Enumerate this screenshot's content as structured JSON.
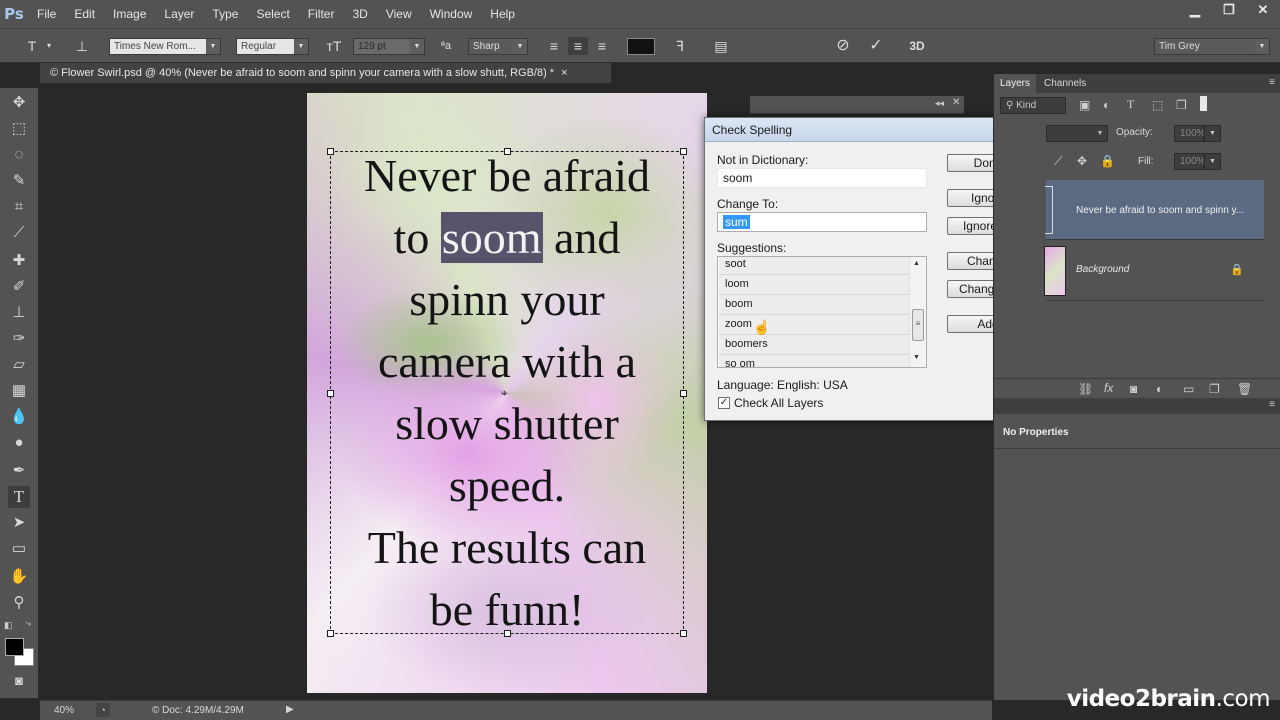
{
  "app": {
    "logo": "Ps",
    "menu": [
      "File",
      "Edit",
      "Image",
      "Layer",
      "Type",
      "Select",
      "Filter",
      "3D",
      "View",
      "Window",
      "Help"
    ],
    "window_controls": {
      "minimize": "▁",
      "restore": "❐",
      "close": "✕"
    }
  },
  "options_bar": {
    "font_family": "Times New Rom...",
    "font_style": "Regular",
    "font_size": "129 pt",
    "aa_label": "ªa",
    "anti_alias": "Sharp",
    "text_color": "#111111",
    "workspace": "Tim Grey",
    "three_d": "3D"
  },
  "document": {
    "tab_title": "© Flower Swirl.psd @ 40% (Never be afraid to soom and spinn your camera with a slow shutt, RGB/8) *",
    "tab_close": "×",
    "lines": [
      {
        "pre": "Never be afraid",
        "hl": "",
        "post": ""
      },
      {
        "pre": "to ",
        "hl": "soom",
        "post": " and"
      },
      {
        "pre": "spinn your",
        "hl": "",
        "post": ""
      },
      {
        "pre": "camera with a",
        "hl": "",
        "post": ""
      },
      {
        "pre": "slow shutter",
        "hl": "",
        "post": ""
      },
      {
        "pre": "speed.",
        "hl": "",
        "post": ""
      },
      {
        "pre": "The results can",
        "hl": "",
        "post": ""
      },
      {
        "pre": "be funn!",
        "hl": "",
        "post": ""
      }
    ]
  },
  "dialog": {
    "title": "Check Spelling",
    "close": "✕",
    "not_in_dictionary_label": "Not in Dictionary:",
    "not_in_dictionary_value": "soom",
    "change_to_label": "Change To:",
    "change_to_value": "sum",
    "suggestions_label": "Suggestions:",
    "suggestions": [
      "soot",
      "loom",
      "boom",
      "zoom",
      "boomers",
      "so om"
    ],
    "buttons": {
      "done": "Done",
      "ignore": "Ignore",
      "ignore_all": "Ignore All",
      "change": "Change",
      "change_all": "Change All",
      "add": "Add"
    },
    "language": "Language: English: USA",
    "check_all_layers": "Check All Layers",
    "check_all_layers_checked": true
  },
  "layers_panel": {
    "tabs": [
      "Layers",
      "Channels"
    ],
    "filter_kind": "Kind",
    "opacity_label": "Opacity:",
    "opacity_value": "100%",
    "fill_label": "Fill:",
    "fill_value": "100%",
    "layers": [
      {
        "name": "Never be afraid to soom and spinn y...",
        "type": "text",
        "selected": true
      },
      {
        "name": "Background",
        "type": "image",
        "locked": true
      }
    ],
    "footer_fx": "fx"
  },
  "properties_panel": {
    "empty_text": "No Properties"
  },
  "status_bar": {
    "zoom": "40%",
    "doc_info": "© Doc: 4.29M/4.29M"
  },
  "watermark": {
    "brand": "video2brain",
    "tld": ".com"
  }
}
